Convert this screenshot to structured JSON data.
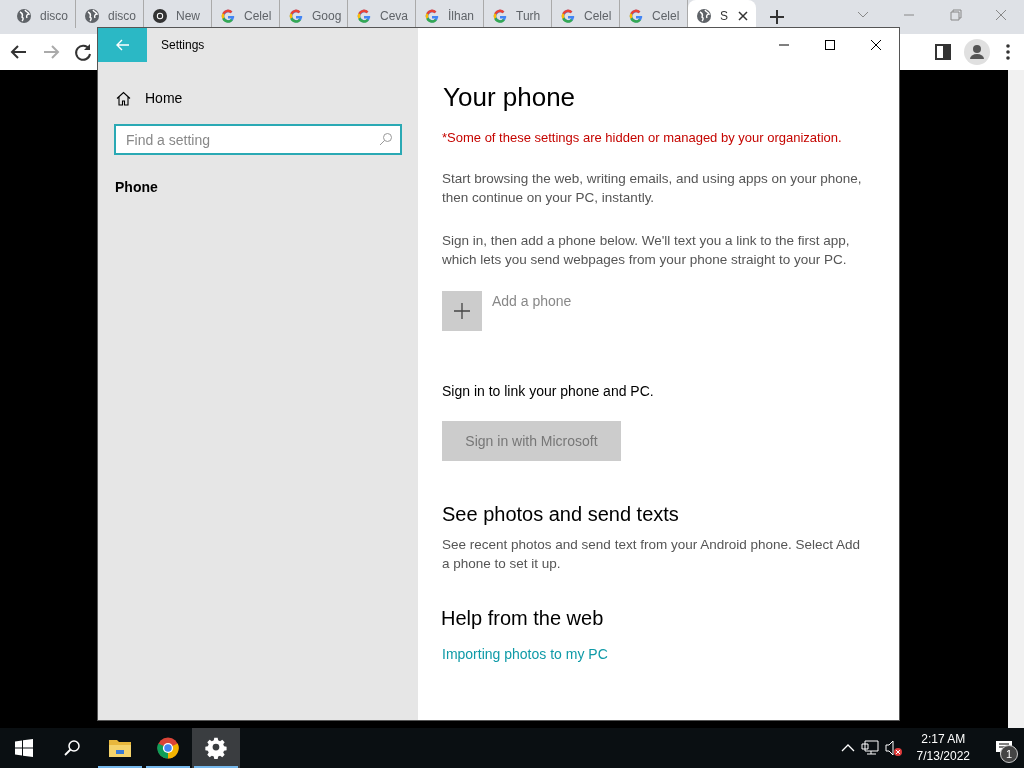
{
  "browser": {
    "tabs": [
      {
        "kind": "globe",
        "label": "disco",
        "selected": false
      },
      {
        "kind": "globe",
        "label": "disco",
        "selected": false
      },
      {
        "kind": "chrome",
        "label": "New",
        "selected": false
      },
      {
        "kind": "google",
        "label": "Celel",
        "selected": false
      },
      {
        "kind": "google",
        "label": "Goog",
        "selected": false
      },
      {
        "kind": "google",
        "label": "Ceva",
        "selected": false
      },
      {
        "kind": "google",
        "label": "İlhan",
        "selected": false
      },
      {
        "kind": "google",
        "label": "Turh",
        "selected": false
      },
      {
        "kind": "google",
        "label": "Celel",
        "selected": false
      },
      {
        "kind": "google",
        "label": "Celel",
        "selected": false
      },
      {
        "kind": "globe",
        "label": "S",
        "selected": true
      }
    ]
  },
  "settings_window": {
    "title": "Settings",
    "sidebar": {
      "home": "Home",
      "search": {
        "placeholder": "Find a setting"
      },
      "items": [
        {
          "label": "Phone",
          "selected": true
        }
      ]
    },
    "content": {
      "title": "Your phone",
      "notice": "*Some of these settings are hidden or managed by your organization.",
      "paragraphs": [
        "Start browsing the web, writing emails, and using apps on your phone, then continue on your PC, instantly.",
        "Sign in, then add a phone below. We'll text you a link to the first app, which lets you send webpages from your phone straight to your PC."
      ],
      "add_phone": {
        "label": "Add a phone"
      },
      "sign_in_text": "Sign in to link your phone and PC.",
      "sign_in_button": {
        "label": "Sign in with Microsoft",
        "disabled": true
      },
      "sections": [
        {
          "heading": "See photos and send texts",
          "text": "See recent photos and send text from your Android phone. Select Add a phone to set it up."
        },
        {
          "heading": "Help from the web",
          "link": "Importing photos to my PC"
        }
      ]
    }
  },
  "taskbar": {
    "apps": [
      {
        "kind": "explorer",
        "selected": false
      },
      {
        "kind": "chrome",
        "selected": false
      },
      {
        "kind": "settings",
        "selected": true
      }
    ],
    "time": "2:17 AM",
    "date": "7/13/2022",
    "notification_count": "1"
  }
}
